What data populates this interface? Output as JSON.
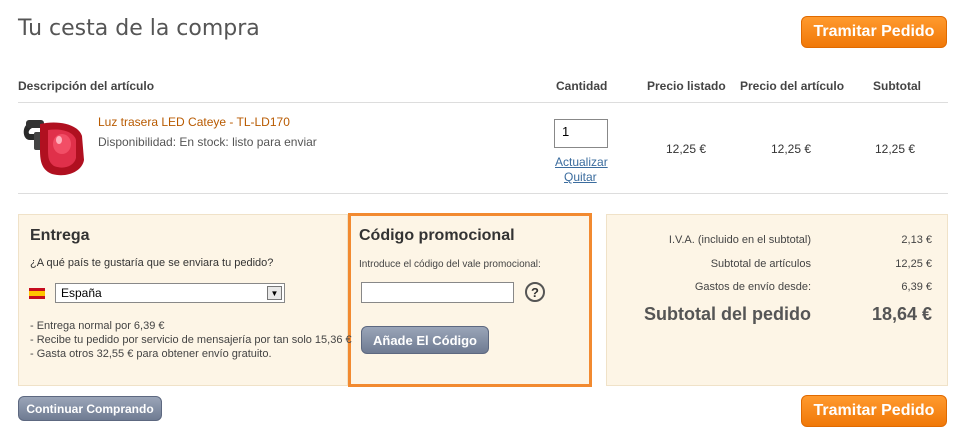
{
  "header": {
    "title": "Tu cesta de la compra",
    "checkout_label": "Tramitar Pedido"
  },
  "table": {
    "headers": {
      "description": "Descripción del artículo",
      "quantity": "Cantidad",
      "list_price": "Precio listado",
      "item_price": "Precio del artículo",
      "subtotal": "Subtotal"
    },
    "rows": [
      {
        "name": "Luz trasera LED Cateye - TL-LD170",
        "availability": "Disponibilidad: En stock: listo para enviar",
        "quantity": "1",
        "update_label": "Actualizar",
        "remove_label": "Quitar",
        "list_price": "12,25 €",
        "item_price": "12,25 €",
        "subtotal": "12,25 €"
      }
    ]
  },
  "shipping": {
    "title": "Entrega",
    "question": "¿A qué país te gustaría que se enviara tu pedido?",
    "country": "España",
    "notes": [
      "- Entrega normal por 6,39 €",
      "- Recibe tu pedido por servicio de mensajería por tan solo 15,36 €",
      "- Gasta otros 32,55 € para obtener envío gratuito."
    ]
  },
  "promo": {
    "title": "Código promocional",
    "label": "Introduce el código del vale promocional:",
    "value": "",
    "help": "?",
    "button_label": "Añade El Código"
  },
  "totals": {
    "vat_label": "I.V.A. (incluido en el subtotal)",
    "vat_value": "2,13 €",
    "items_label": "Subtotal de artículos",
    "items_value": "12,25 €",
    "shipping_label": "Gastos de envío desde:",
    "shipping_value": "6,39 €",
    "order_label": "Subtotal del pedido",
    "order_value": "18,64 €"
  },
  "footer": {
    "continue_label": "Continuar Comprando",
    "checkout_label": "Tramitar Pedido"
  },
  "colors": {
    "accent": "#f07808",
    "panel_bg": "#fdf5e6",
    "highlight_border": "#f28a30",
    "link": "#b85a00"
  }
}
